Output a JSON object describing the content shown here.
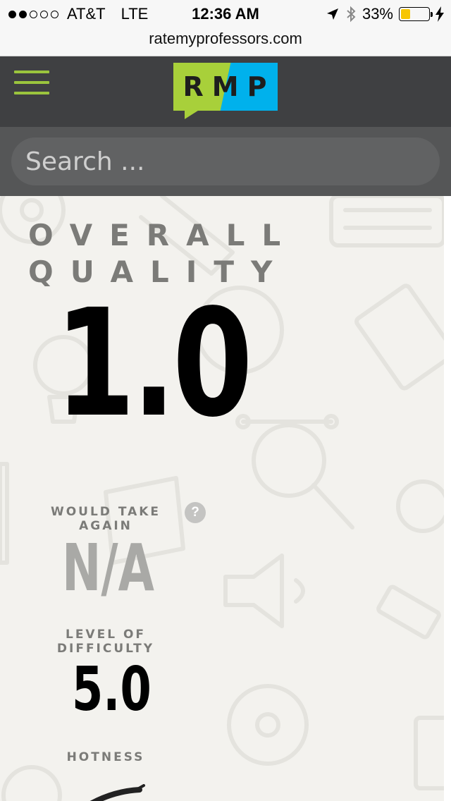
{
  "status_bar": {
    "signal_dots": [
      true,
      true,
      false,
      false,
      false
    ],
    "carrier": "AT&T",
    "network": "LTE",
    "time": "12:36 AM",
    "battery_percent": "33%",
    "battery_level": 0.33,
    "icons": [
      "location-arrow-icon",
      "bluetooth-icon",
      "battery-icon",
      "charging-bolt-icon"
    ]
  },
  "url_bar": {
    "domain": "ratemyprofessors.com"
  },
  "header": {
    "menu_icon": "hamburger-menu-icon",
    "logo_text": "RMP",
    "colors": {
      "header_bg": "#3f4042",
      "accent_green": "#a8d03a",
      "accent_blue": "#00b1ec"
    }
  },
  "search": {
    "placeholder": "Search ..."
  },
  "rating": {
    "overall_label": "OVERALL QUALITY",
    "overall_value": "1.0",
    "would_take_again_label": "WOULD TAKE AGAIN",
    "would_take_again_help": "?",
    "would_take_again_value": "N/A",
    "difficulty_label": "LEVEL OF DIFFICULTY",
    "difficulty_value": "5.0",
    "hotness_label": "HOTNESS",
    "hotness_icon": "chili-pepper-icon"
  }
}
